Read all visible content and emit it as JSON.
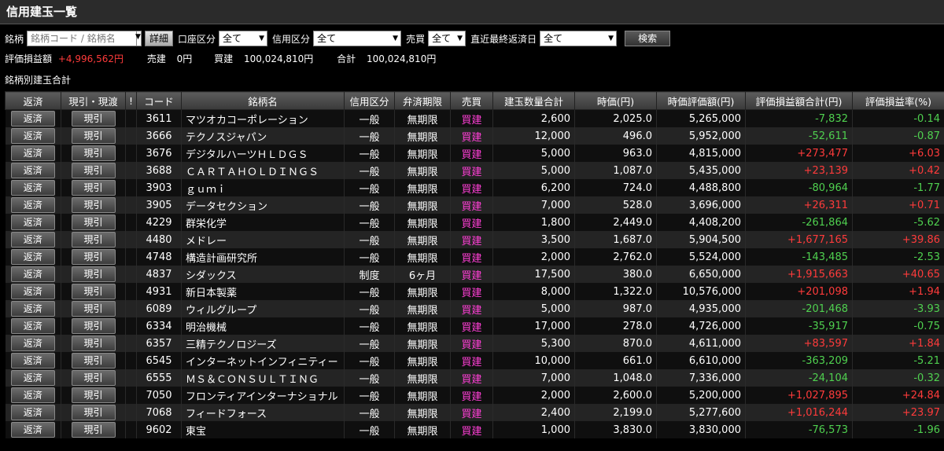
{
  "title": "信用建玉一覧",
  "filters": {
    "meigara_label": "銘柄",
    "search_placeholder": "銘柄コード / 銘柄名",
    "detail_button": "詳細",
    "account_label": "口座区分",
    "account_value": "全て",
    "credit_label": "信用区分",
    "credit_value": "全て",
    "trade_label": "売買",
    "trade_value": "全て",
    "due_label": "直近最終返済日",
    "due_value": "全て",
    "search_button": "検索"
  },
  "summary": {
    "pl_label": "評価損益額",
    "pl_value": "+4,996,562円",
    "sell_label": "売建",
    "sell_value": "0円",
    "buy_label": "買建",
    "buy_value": "100,024,810円",
    "total_label": "合計",
    "total_value": "100,024,810円"
  },
  "section_title": "銘柄別建玉合計",
  "table": {
    "headers": [
      "返済",
      "現引・現渡",
      "!",
      "コード",
      "銘柄名",
      "信用区分",
      "弁済期限",
      "売買",
      "建玉数量合計",
      "時価(円)",
      "時価評価額(円)",
      "評価損益額合計(円)",
      "評価損益率(%)"
    ],
    "repay_button": "返済",
    "genbiki_button": "現引",
    "rows": [
      {
        "code": "3611",
        "name": "マツオカコーポレーション",
        "credit": "一般",
        "term": "無期限",
        "side": "買建",
        "qty": "2,600",
        "price": "2,025.0",
        "value": "5,265,000",
        "pl": "-7,832",
        "rate": "-0.14"
      },
      {
        "code": "3666",
        "name": "テクノスジャパン",
        "credit": "一般",
        "term": "無期限",
        "side": "買建",
        "qty": "12,000",
        "price": "496.0",
        "value": "5,952,000",
        "pl": "-52,611",
        "rate": "-0.87"
      },
      {
        "code": "3676",
        "name": "デジタルハーツＨＬＤＧＳ",
        "credit": "一般",
        "term": "無期限",
        "side": "買建",
        "qty": "5,000",
        "price": "963.0",
        "value": "4,815,000",
        "pl": "+273,477",
        "rate": "+6.03"
      },
      {
        "code": "3688",
        "name": "ＣＡＲＴＡＨＯＬＤＩＮＧＳ",
        "credit": "一般",
        "term": "無期限",
        "side": "買建",
        "qty": "5,000",
        "price": "1,087.0",
        "value": "5,435,000",
        "pl": "+23,139",
        "rate": "+0.42"
      },
      {
        "code": "3903",
        "name": "ｇｕｍｉ",
        "credit": "一般",
        "term": "無期限",
        "side": "買建",
        "qty": "6,200",
        "price": "724.0",
        "value": "4,488,800",
        "pl": "-80,964",
        "rate": "-1.77"
      },
      {
        "code": "3905",
        "name": "データセクション",
        "credit": "一般",
        "term": "無期限",
        "side": "買建",
        "qty": "7,000",
        "price": "528.0",
        "value": "3,696,000",
        "pl": "+26,311",
        "rate": "+0.71"
      },
      {
        "code": "4229",
        "name": "群栄化学",
        "credit": "一般",
        "term": "無期限",
        "side": "買建",
        "qty": "1,800",
        "price": "2,449.0",
        "value": "4,408,200",
        "pl": "-261,864",
        "rate": "-5.62"
      },
      {
        "code": "4480",
        "name": "メドレー",
        "credit": "一般",
        "term": "無期限",
        "side": "買建",
        "qty": "3,500",
        "price": "1,687.0",
        "value": "5,904,500",
        "pl": "+1,677,165",
        "rate": "+39.86"
      },
      {
        "code": "4748",
        "name": "構造計画研究所",
        "credit": "一般",
        "term": "無期限",
        "side": "買建",
        "qty": "2,000",
        "price": "2,762.0",
        "value": "5,524,000",
        "pl": "-143,485",
        "rate": "-2.53"
      },
      {
        "code": "4837",
        "name": "シダックス",
        "credit": "制度",
        "term": "6ヶ月",
        "side": "買建",
        "qty": "17,500",
        "price": "380.0",
        "value": "6,650,000",
        "pl": "+1,915,663",
        "rate": "+40.65"
      },
      {
        "code": "4931",
        "name": "新日本製薬",
        "credit": "一般",
        "term": "無期限",
        "side": "買建",
        "qty": "8,000",
        "price": "1,322.0",
        "value": "10,576,000",
        "pl": "+201,098",
        "rate": "+1.94"
      },
      {
        "code": "6089",
        "name": "ウィルグループ",
        "credit": "一般",
        "term": "無期限",
        "side": "買建",
        "qty": "5,000",
        "price": "987.0",
        "value": "4,935,000",
        "pl": "-201,468",
        "rate": "-3.93"
      },
      {
        "code": "6334",
        "name": "明治機械",
        "credit": "一般",
        "term": "無期限",
        "side": "買建",
        "qty": "17,000",
        "price": "278.0",
        "value": "4,726,000",
        "pl": "-35,917",
        "rate": "-0.75"
      },
      {
        "code": "6357",
        "name": "三精テクノロジーズ",
        "credit": "一般",
        "term": "無期限",
        "side": "買建",
        "qty": "5,300",
        "price": "870.0",
        "value": "4,611,000",
        "pl": "+83,597",
        "rate": "+1.84"
      },
      {
        "code": "6545",
        "name": "インターネットインフィニティー",
        "credit": "一般",
        "term": "無期限",
        "side": "買建",
        "qty": "10,000",
        "price": "661.0",
        "value": "6,610,000",
        "pl": "-363,209",
        "rate": "-5.21"
      },
      {
        "code": "6555",
        "name": "ＭＳ＆ＣＯＮＳＵＬＴＩＮＧ",
        "credit": "一般",
        "term": "無期限",
        "side": "買建",
        "qty": "7,000",
        "price": "1,048.0",
        "value": "7,336,000",
        "pl": "-24,104",
        "rate": "-0.32"
      },
      {
        "code": "7050",
        "name": "フロンティアインターナショナル",
        "credit": "一般",
        "term": "無期限",
        "side": "買建",
        "qty": "2,000",
        "price": "2,600.0",
        "value": "5,200,000",
        "pl": "+1,027,895",
        "rate": "+24.84"
      },
      {
        "code": "7068",
        "name": "フィードフォース",
        "credit": "一般",
        "term": "無期限",
        "side": "買建",
        "qty": "2,400",
        "price": "2,199.0",
        "value": "5,277,600",
        "pl": "+1,016,244",
        "rate": "+23.97"
      },
      {
        "code": "9602",
        "name": "東宝",
        "credit": "一般",
        "term": "無期限",
        "side": "買建",
        "qty": "1,000",
        "price": "3,830.0",
        "value": "3,830,000",
        "pl": "-76,573",
        "rate": "-1.96"
      }
    ]
  },
  "colors": {
    "positive": "#ff3b3b",
    "negative": "#4fd04f",
    "side": "#ff3fd6"
  }
}
